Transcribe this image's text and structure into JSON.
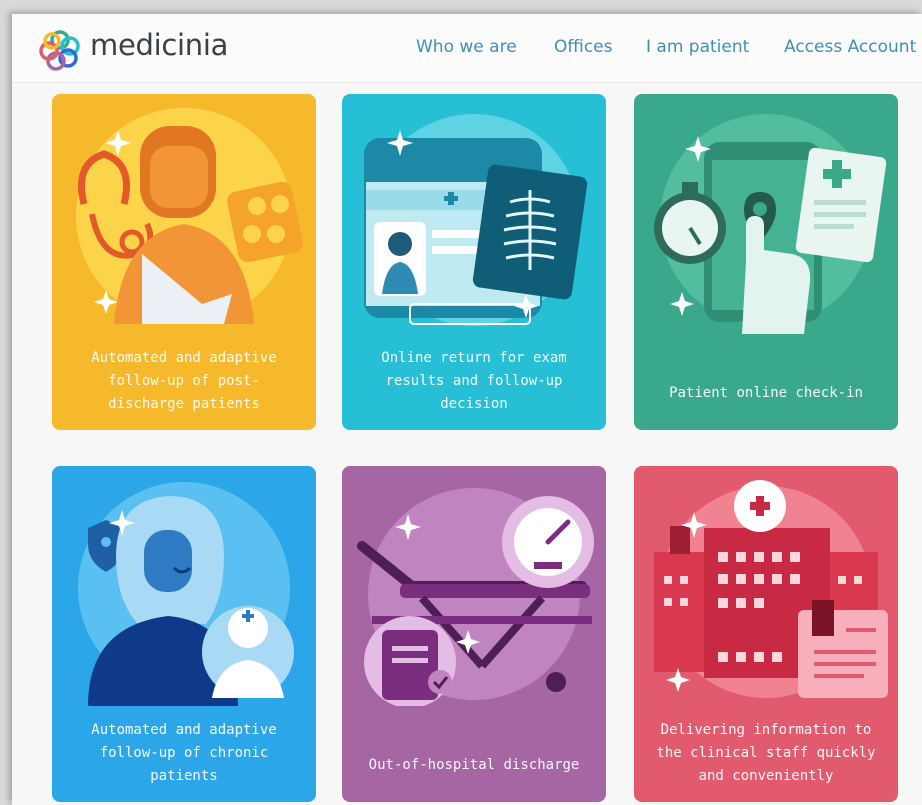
{
  "brand": {
    "name": "medicinia",
    "logo_icon": "interlocking-rings-logo"
  },
  "nav": {
    "who": "Who we are",
    "offices": "Offices",
    "patient": "I am patient",
    "access": "Access Account"
  },
  "colors": {
    "nav_link": "#3f8fb4",
    "card1": "#f6b92b",
    "card2": "#27bfd6",
    "card3": "#3aa88a",
    "card4": "#2ba6e8",
    "card5": "#a666a4",
    "card6": "#e25a6d"
  },
  "cards": [
    {
      "caption": "Automated and adaptive follow-up of post-discharge patients",
      "icon": "injured-patient-stethoscope-pills-icon"
    },
    {
      "caption": "Online return for exam results and follow-up decision",
      "icon": "tablet-xray-icon"
    },
    {
      "caption": "Patient online check-in",
      "icon": "stopwatch-phone-checkin-icon"
    },
    {
      "caption": "Automated and adaptive follow-up of chronic patients",
      "icon": "patient-nurse-shield-icon"
    },
    {
      "caption": "Out-of-hospital discharge",
      "icon": "stretcher-gauge-clipboard-icon"
    },
    {
      "caption": "Delivering information to the clinical staff quickly and conveniently",
      "icon": "hospital-building-document-icon"
    }
  ]
}
